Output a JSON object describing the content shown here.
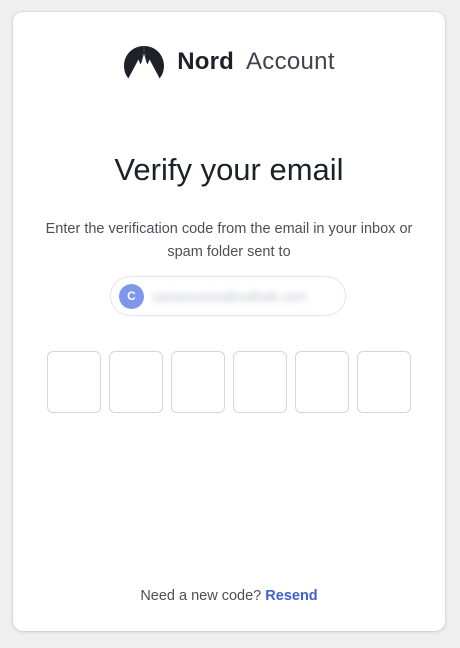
{
  "brand": {
    "icon": "nord-mountain-icon",
    "word": "Nord",
    "product": "Account"
  },
  "verify": {
    "title": "Verify your email",
    "instructions": "Enter the verification code from the email in your inbox or spam folder sent to",
    "email": {
      "avatar_initial": "C",
      "address_obscured": "ciprianrusen@outlook.com"
    },
    "code_boxes": [
      "",
      "",
      "",
      "",
      "",
      ""
    ]
  },
  "footer": {
    "prompt": "Need a new code?",
    "resend_label": "Resend"
  },
  "colors": {
    "accent": "#3e5fd6",
    "avatar": "#7e97ea",
    "text": "#1e2128"
  }
}
